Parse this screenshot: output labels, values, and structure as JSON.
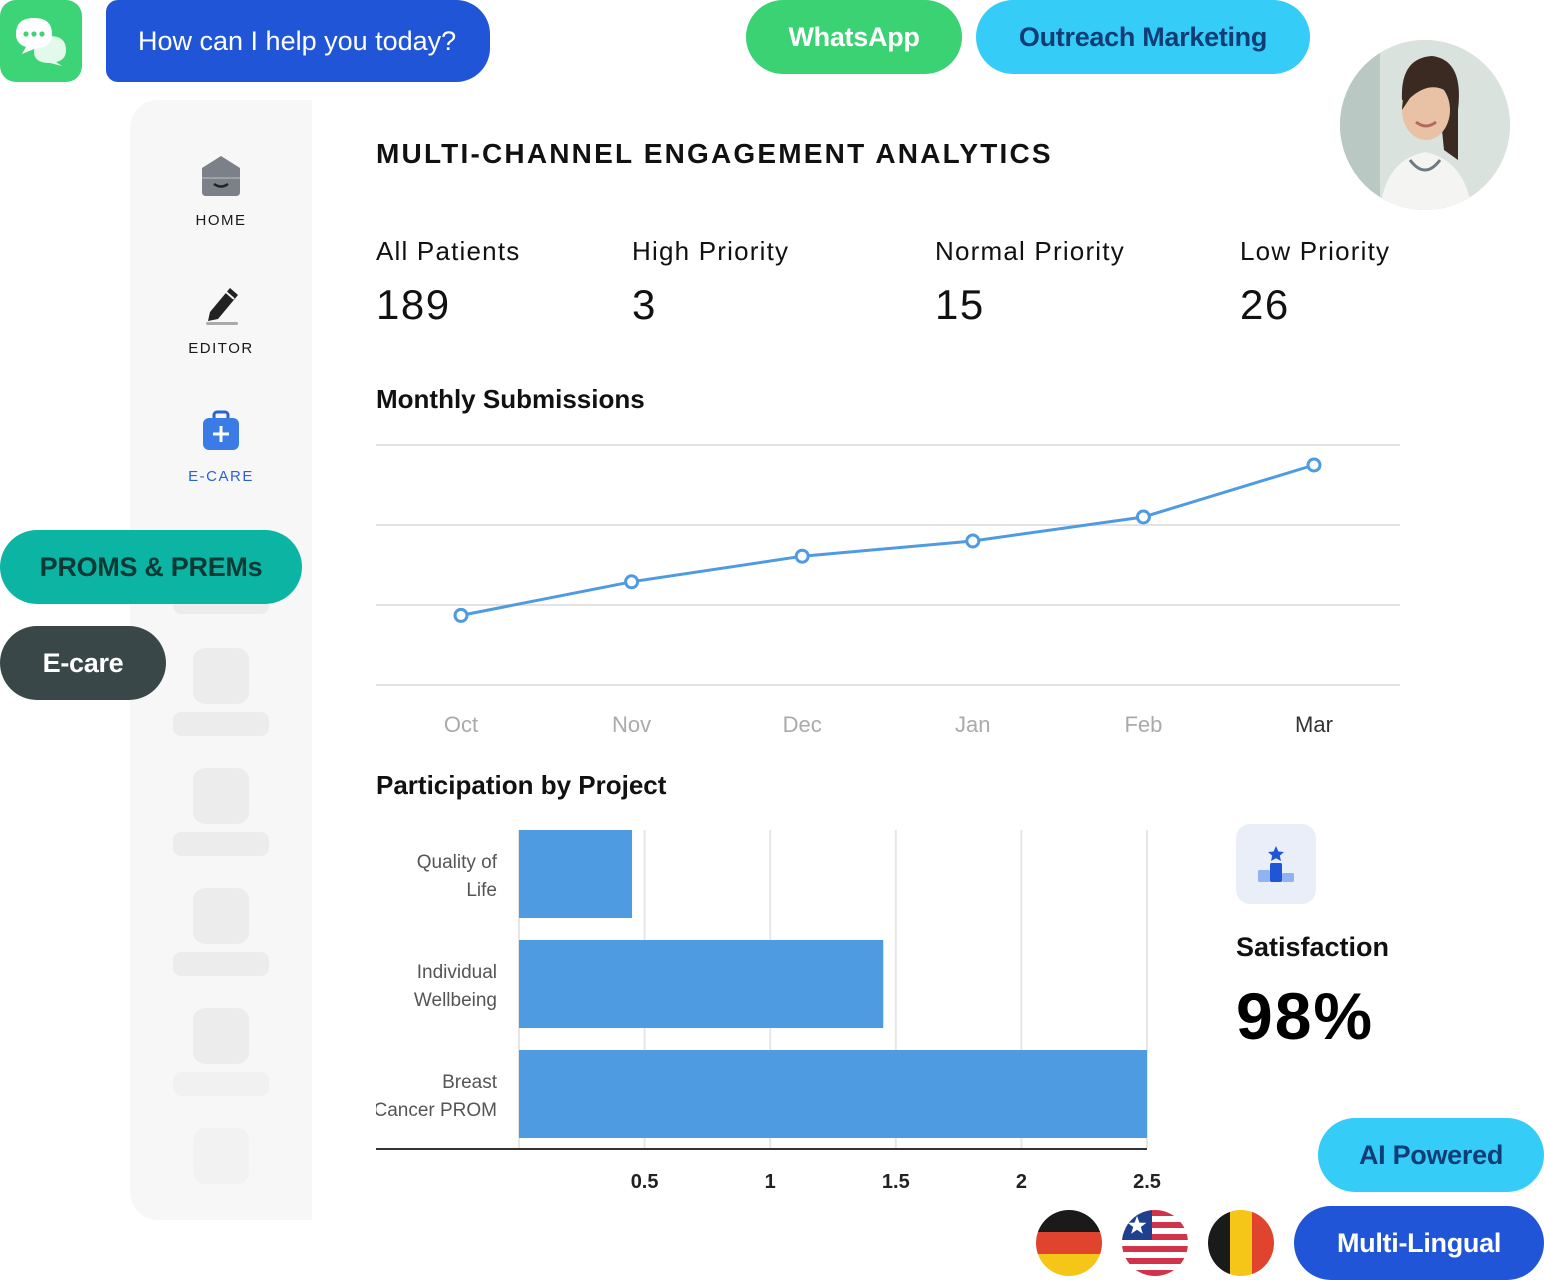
{
  "chat": {
    "prompt": "How can I help you today?"
  },
  "badges": {
    "whatsapp": "WhatsApp",
    "outreach": "Outreach Marketing",
    "proms": "PROMS & PREMs",
    "ecare": "E-care",
    "ai": "AI Powered",
    "multilingual": "Multi-Lingual"
  },
  "sidebar": {
    "items": [
      {
        "label": "HOME",
        "icon": "home-icon"
      },
      {
        "label": "EDITOR",
        "icon": "pencil-icon"
      },
      {
        "label": "E-CARE",
        "icon": "medical-kit-icon",
        "active": true
      }
    ]
  },
  "dashboard": {
    "title": "MULTI-CHANNEL ENGAGEMENT ANALYTICS",
    "stats": [
      {
        "label": "All Patients",
        "value": "189"
      },
      {
        "label": "High Priority",
        "value": "3"
      },
      {
        "label": "Normal Priority",
        "value": "15"
      },
      {
        "label": "Low Priority",
        "value": "26"
      }
    ],
    "monthly_title": "Monthly Submissions",
    "participation_title": "Participation by Project"
  },
  "satisfaction": {
    "label": "Satisfaction",
    "value": "98%",
    "icon": "podium-star-icon"
  },
  "flags": [
    "germany-flag-icon",
    "liberia-flag-icon",
    "belgium-flag-icon"
  ],
  "colors": {
    "accent_blue": "#1f55d6",
    "green": "#3ad273",
    "cyan": "#35cdf7",
    "teal": "#0cb4a4",
    "chart_blue": "#4f9be2"
  },
  "chart_data": [
    {
      "type": "line",
      "title": "Monthly Submissions",
      "categories": [
        "Oct",
        "Nov",
        "Dec",
        "Jan",
        "Feb",
        "Mar"
      ],
      "values": [
        0.87,
        1.29,
        1.61,
        1.8,
        2.1,
        2.75
      ],
      "ylim": [
        0,
        3
      ],
      "grid": true
    },
    {
      "type": "bar",
      "orientation": "horizontal",
      "title": "Participation by Project",
      "categories": [
        "Quality of Life",
        "Individual Wellbeing",
        "Breast Cancer PROM"
      ],
      "values": [
        0.45,
        1.45,
        2.5
      ],
      "xticks": [
        "0.5",
        "1",
        "1.5",
        "2",
        "2.5"
      ],
      "xlim": [
        0,
        2.5
      ],
      "grid": true
    }
  ]
}
